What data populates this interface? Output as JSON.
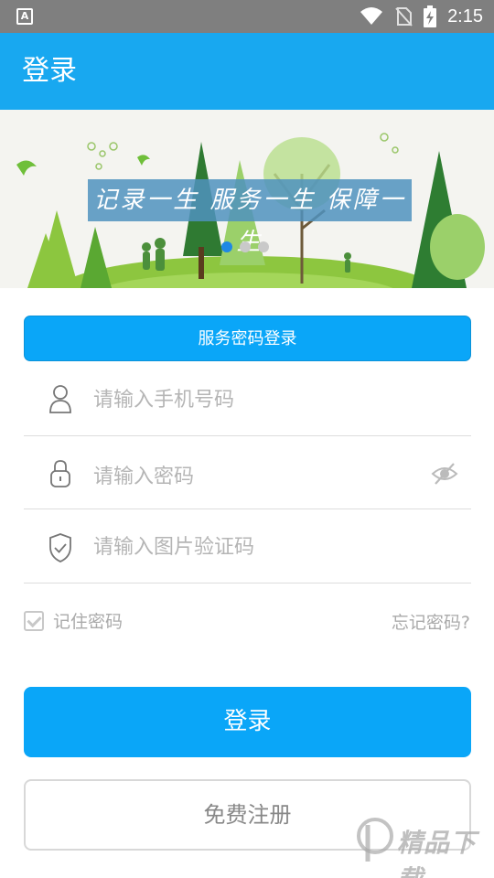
{
  "status_bar": {
    "app_icon_letter": "A",
    "time": "2:15"
  },
  "app_bar": {
    "title": "登录"
  },
  "banner": {
    "slogan": "记录一生 服务一生 保障一生",
    "slides": 3,
    "active_slide": 1
  },
  "login_tab": {
    "label": "服务密码登录"
  },
  "form": {
    "phone_placeholder": "请输入手机号码",
    "password_placeholder": "请输入密码",
    "captcha_placeholder": "请输入图片验证码"
  },
  "options": {
    "remember_label": "记住密码",
    "remember_checked": true,
    "forgot_label": "忘记密码?"
  },
  "actions": {
    "login_label": "登录",
    "register_label": "免费注册"
  },
  "watermark": {
    "text": "精品下载"
  },
  "colors": {
    "primary": "#0aa6f8",
    "app_bar": "#18a8f0",
    "status_bar": "#7f7f7f"
  }
}
